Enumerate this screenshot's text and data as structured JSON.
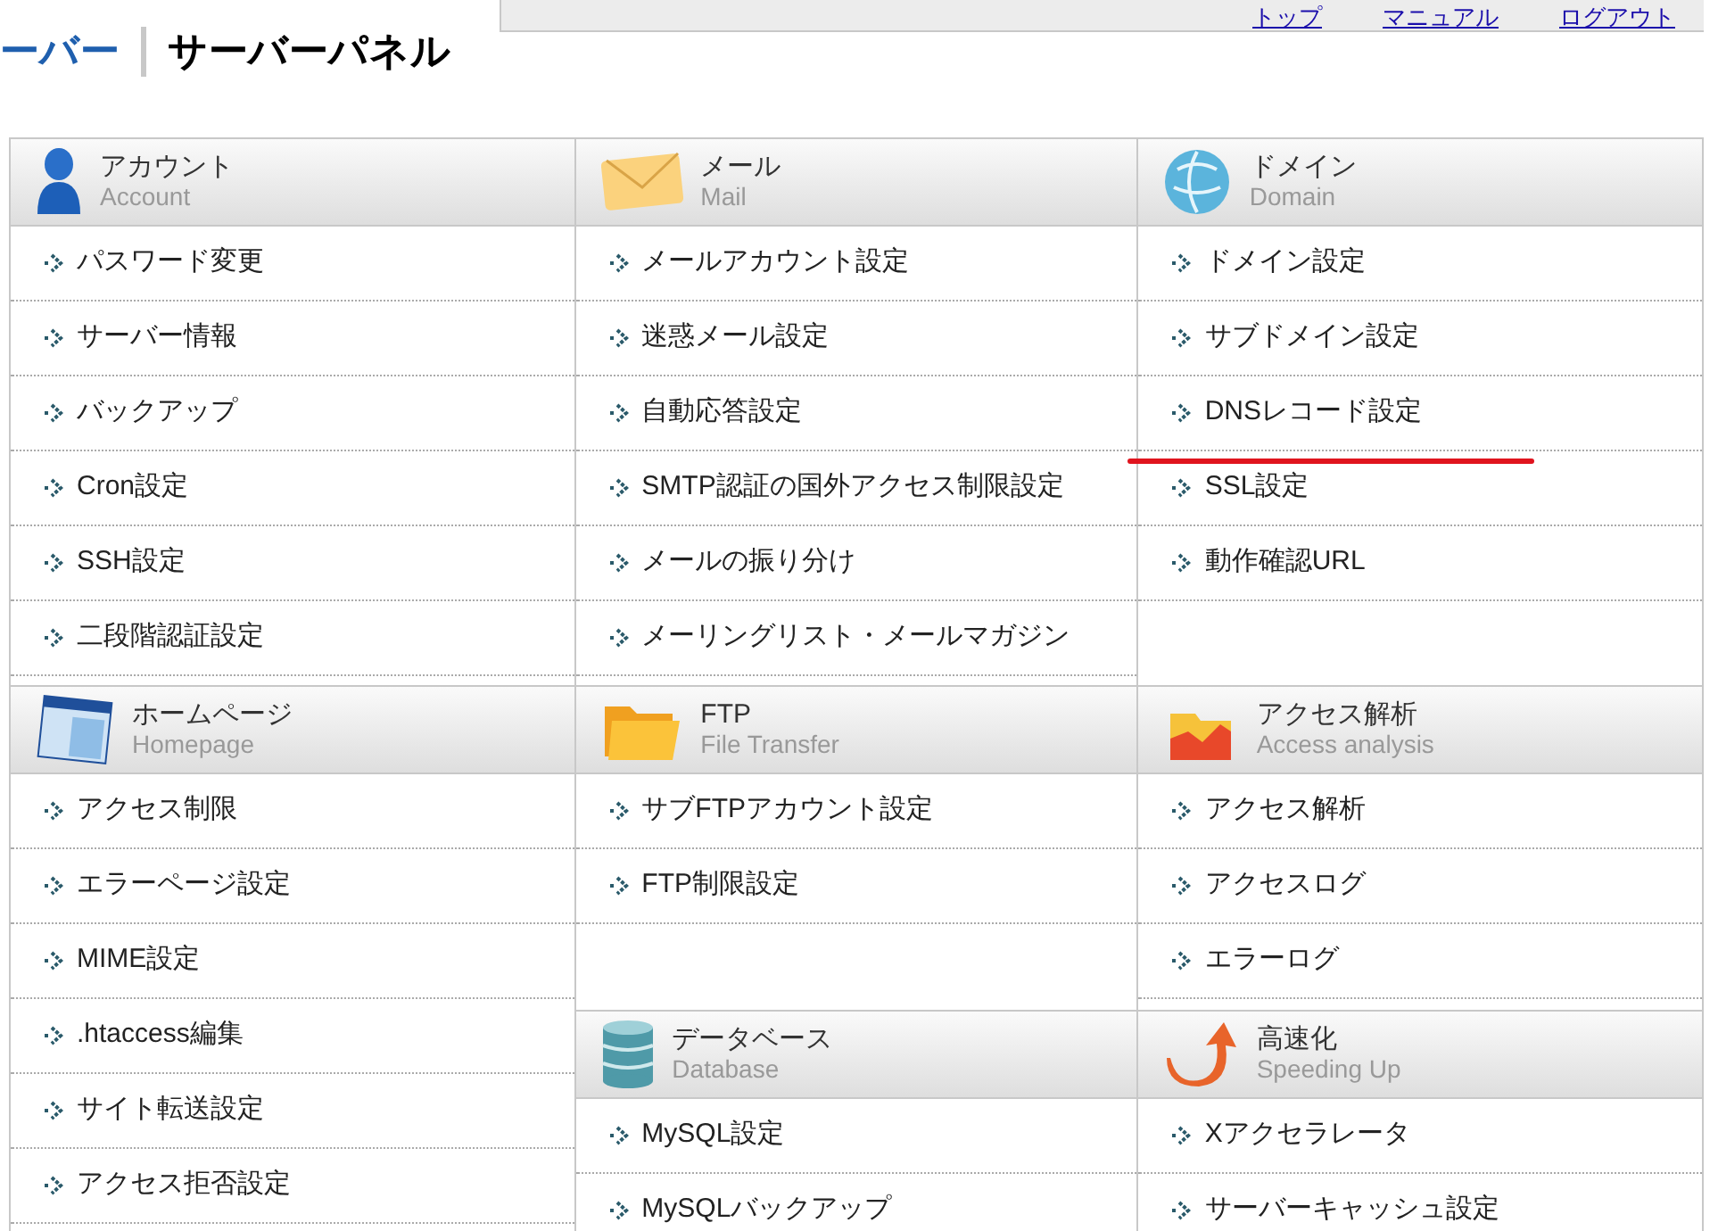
{
  "header": {
    "logo_text": "ーバー",
    "title": "サーバーパネル",
    "nav_links": [
      "トップ",
      "マニュアル",
      "ログアウト"
    ]
  },
  "columns": [
    {
      "sections": [
        {
          "kind": "account",
          "title": "アカウント",
          "subtitle": "Account",
          "items": [
            {
              "label": "パスワード変更",
              "underlined": false
            },
            {
              "label": "サーバー情報",
              "underlined": false
            },
            {
              "label": "バックアップ",
              "underlined": false
            },
            {
              "label": "Cron設定",
              "underlined": false
            },
            {
              "label": "SSH設定",
              "underlined": false
            },
            {
              "label": "二段階認証設定",
              "underlined": false
            }
          ]
        },
        {
          "kind": "homepage",
          "title": "ホームページ",
          "subtitle": "Homepage",
          "items": [
            {
              "label": "アクセス制限",
              "underlined": false
            },
            {
              "label": "エラーページ設定",
              "underlined": false
            },
            {
              "label": "MIME設定",
              "underlined": false
            },
            {
              "label": ".htaccess編集",
              "underlined": false
            },
            {
              "label": "サイト転送設定",
              "underlined": false
            },
            {
              "label": "アクセス拒否設定",
              "underlined": false
            }
          ]
        }
      ]
    },
    {
      "sections": [
        {
          "kind": "mail",
          "title": "メール",
          "subtitle": "Mail",
          "items": [
            {
              "label": "メールアカウント設定",
              "underlined": false
            },
            {
              "label": "迷惑メール設定",
              "underlined": false
            },
            {
              "label": "自動応答設定",
              "underlined": false
            },
            {
              "label": "SMTP認証の国外アクセス制限設定",
              "underlined": false
            },
            {
              "label": "メールの振り分け",
              "underlined": false
            },
            {
              "label": "メーリングリスト・メールマガジン",
              "underlined": false
            }
          ]
        },
        {
          "kind": "ftp",
          "title": "FTP",
          "subtitle": "File Transfer",
          "items": [
            {
              "label": "サブFTPアカウント設定",
              "underlined": false
            },
            {
              "label": "FTP制限設定",
              "underlined": false
            }
          ]
        },
        {
          "kind": "database",
          "title": "データベース",
          "subtitle": "Database",
          "items": [
            {
              "label": "MySQL設定",
              "underlined": false
            },
            {
              "label": "MySQLバックアップ",
              "underlined": false
            }
          ]
        }
      ]
    },
    {
      "sections": [
        {
          "kind": "domain",
          "title": "ドメイン",
          "subtitle": "Domain",
          "items": [
            {
              "label": "ドメイン設定",
              "underlined": false
            },
            {
              "label": "サブドメイン設定",
              "underlined": false
            },
            {
              "label": "DNSレコード設定",
              "underlined": true
            },
            {
              "label": "SSL設定",
              "underlined": false
            },
            {
              "label": "動作確認URL",
              "underlined": false
            }
          ]
        },
        {
          "kind": "analytics",
          "title": "アクセス解析",
          "subtitle": "Access analysis",
          "items": [
            {
              "label": "アクセス解析",
              "underlined": false
            },
            {
              "label": "アクセスログ",
              "underlined": false
            },
            {
              "label": "エラーログ",
              "underlined": false
            }
          ]
        },
        {
          "kind": "speed",
          "title": "高速化",
          "subtitle": "Speeding Up",
          "items": [
            {
              "label": "Xアクセラレータ",
              "underlined": false
            },
            {
              "label": "サーバーキャッシュ設定",
              "underlined": false
            }
          ]
        }
      ]
    }
  ]
}
